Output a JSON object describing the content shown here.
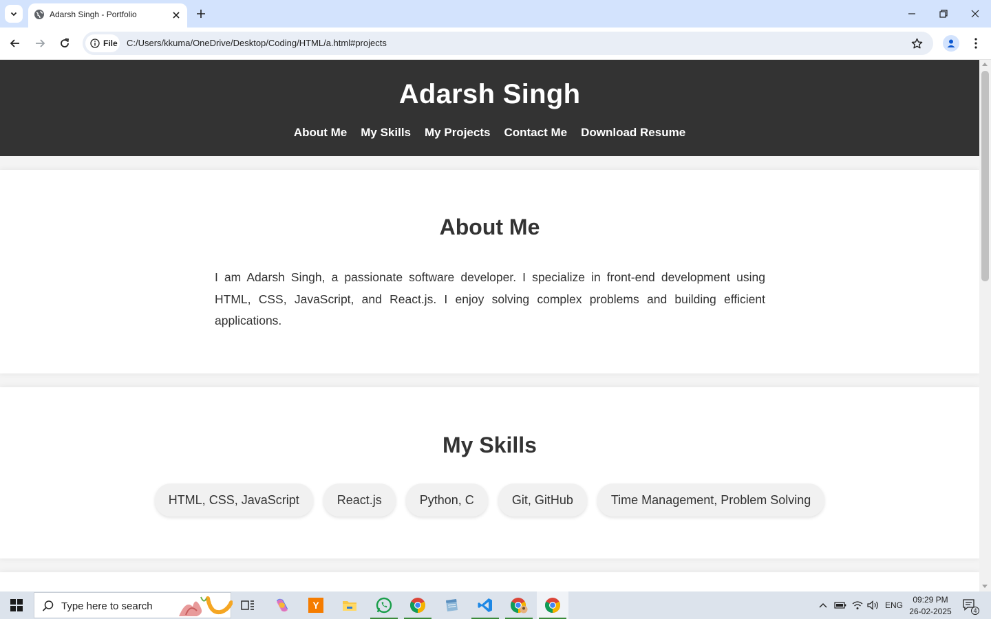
{
  "browser": {
    "tab_title": "Adarsh Singh - Portfolio",
    "address_chip": "File",
    "url": "C:/Users/kkuma/OneDrive/Desktop/Coding/HTML/a.html#projects"
  },
  "page": {
    "site_title": "Adarsh Singh",
    "nav": [
      "About Me",
      "My Skills",
      "My Projects",
      "Contact Me",
      "Download Resume"
    ],
    "about": {
      "heading": "About Me",
      "text": "I am Adarsh Singh, a passionate software developer. I specialize in front-end development using HTML, CSS, JavaScript, and React.js. I enjoy solving complex problems and building efficient applications."
    },
    "skills": {
      "heading": "My Skills",
      "items": [
        "HTML, CSS, JavaScript",
        "React.js",
        "Python, C",
        "Git, GitHub",
        "Time Management, Problem Solving"
      ]
    }
  },
  "taskbar": {
    "search_placeholder": "Type here to search",
    "apps": [
      "task-view",
      "copilot",
      "yandex",
      "file-explorer",
      "whatsapp",
      "chrome",
      "notepad",
      "vscode",
      "chrome-profile",
      "chrome"
    ],
    "language": "ENG",
    "time": "09:29 PM",
    "date": "26-02-2025",
    "notification_count": "4"
  },
  "colors": {
    "header_bg": "#333333",
    "tabbar_bg": "#d3e3fd",
    "page_bg": "#f4f4f4",
    "skill_bg": "#f1f1f1"
  }
}
